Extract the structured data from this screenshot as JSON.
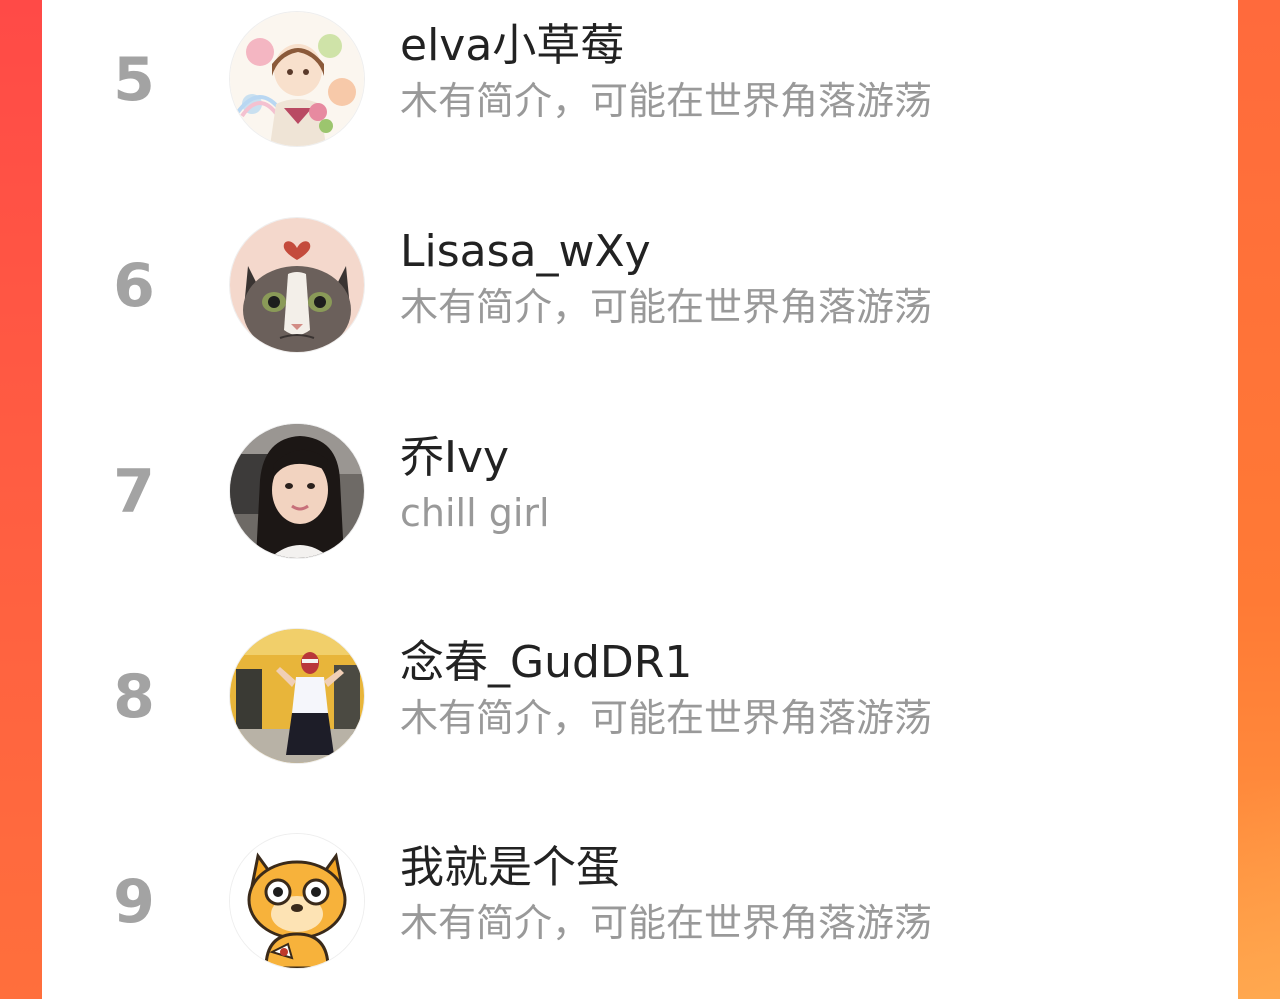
{
  "ranking": {
    "items": [
      {
        "rank": "5",
        "name": "elva小草莓",
        "bio": "木有简介，可能在世界角落游荡",
        "avatar_icon": "floral-girl-illustration-avatar"
      },
      {
        "rank": "6",
        "name": "Lisasa_wXy",
        "bio": "木有简介，可能在世界角落游荡",
        "avatar_icon": "grumpy-cat-avatar"
      },
      {
        "rank": "7",
        "name": "乔Ivy",
        "bio": "chill girl",
        "avatar_icon": "girl-selfie-avatar"
      },
      {
        "rank": "8",
        "name": "念春_GudDR1",
        "bio": "木有简介，可能在世界角落游荡",
        "avatar_icon": "masked-person-avatar"
      },
      {
        "rank": "9",
        "name": "我就是个蛋",
        "bio": "木有简介，可能在世界角落游荡",
        "avatar_icon": "cartoon-dog-avatar"
      }
    ]
  },
  "colors": {
    "background_left": "#ff4a47",
    "background_right": "#ff7a35",
    "rank_number": "#a3a3a3",
    "name_text": "#222222",
    "bio_text": "#999999"
  }
}
